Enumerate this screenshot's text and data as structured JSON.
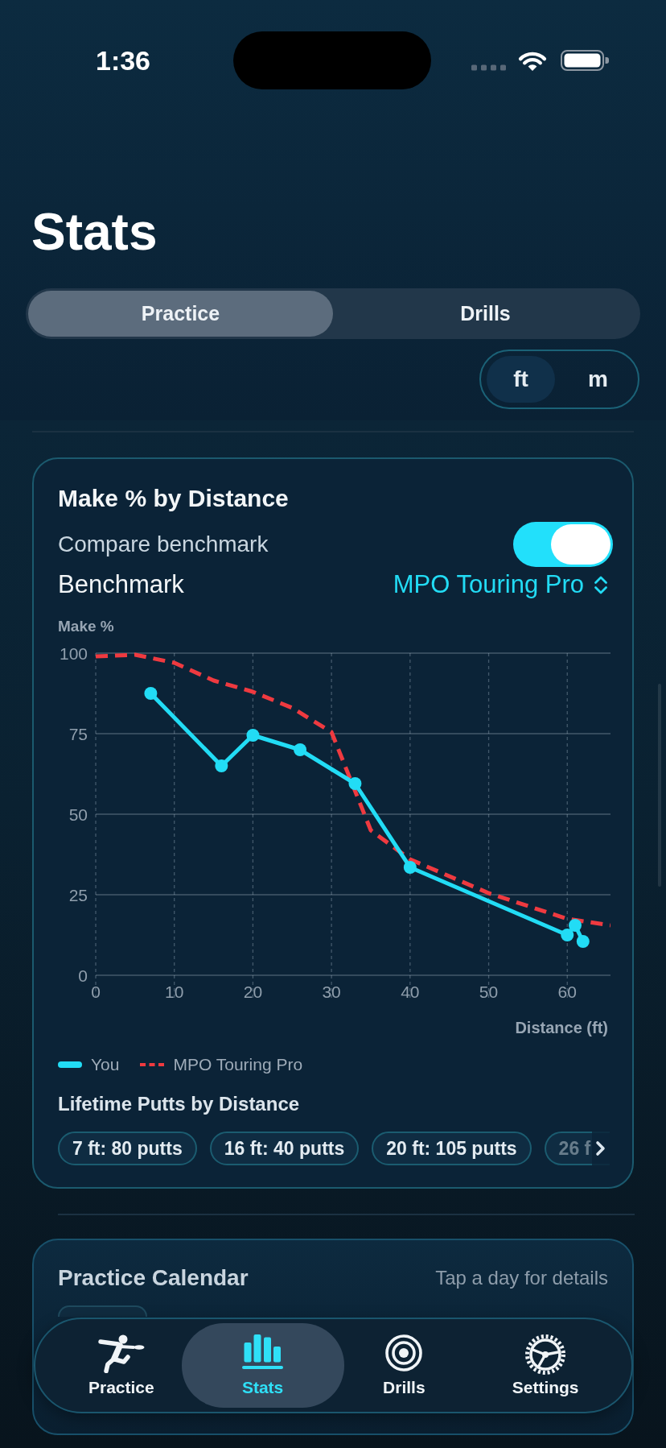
{
  "status_bar": {
    "time": "1:36"
  },
  "header": {
    "title": "Stats",
    "segments": [
      {
        "label": "Practice",
        "selected": true
      },
      {
        "label": "Drills",
        "selected": false
      }
    ],
    "units": [
      {
        "label": "ft",
        "selected": true
      },
      {
        "label": "m",
        "selected": false
      }
    ]
  },
  "make_card": {
    "title": "Make % by Distance",
    "compare": {
      "label": "Compare benchmark",
      "on": true
    },
    "benchmark": {
      "label": "Benchmark",
      "value": "MPO Touring Pro"
    },
    "chart_data": {
      "type": "line",
      "ylabel": "Make %",
      "xlabel": "Distance (ft)",
      "xlim": [
        0,
        65.5
      ],
      "ylim": [
        0,
        100
      ],
      "xticks": [
        0,
        10,
        20,
        30,
        40,
        50,
        60
      ],
      "yticks": [
        0,
        25,
        50,
        75,
        100
      ],
      "grid": true,
      "series": [
        {
          "name": "You",
          "color": "#22dcf5",
          "line_style": "solid",
          "marker": "circle",
          "x": [
            7,
            16,
            20,
            26,
            33,
            40,
            60,
            61,
            62
          ],
          "values": [
            87.5,
            65,
            74.5,
            70,
            59.5,
            33.5,
            12.5,
            15.5,
            10.5
          ]
        },
        {
          "name": "MPO Touring Pro",
          "color": "#ef3a40",
          "line_style": "dashed",
          "x": [
            0,
            5,
            10,
            15,
            20,
            25,
            30,
            35,
            40,
            50,
            60,
            65.5
          ],
          "values": [
            99,
            99.5,
            97,
            91.5,
            88,
            83,
            75.5,
            45,
            36,
            25.5,
            17.5,
            15.5
          ]
        }
      ]
    },
    "putts_title": "Lifetime Putts by Distance",
    "putt_chips": [
      {
        "label": "7 ft: 80 putts",
        "faded": false
      },
      {
        "label": "16 ft: 40 putts",
        "faded": false
      },
      {
        "label": "20 ft: 105 putts",
        "faded": false
      },
      {
        "label": "26 f",
        "faded": true
      }
    ]
  },
  "calendar_card": {
    "title": "Practice Calendar",
    "hint": "Tap a day for details"
  },
  "tab_bar": {
    "tabs": [
      {
        "label": "Practice",
        "selected": false
      },
      {
        "label": "Stats",
        "selected": true
      },
      {
        "label": "Drills",
        "selected": false
      },
      {
        "label": "Settings",
        "selected": false
      }
    ]
  }
}
